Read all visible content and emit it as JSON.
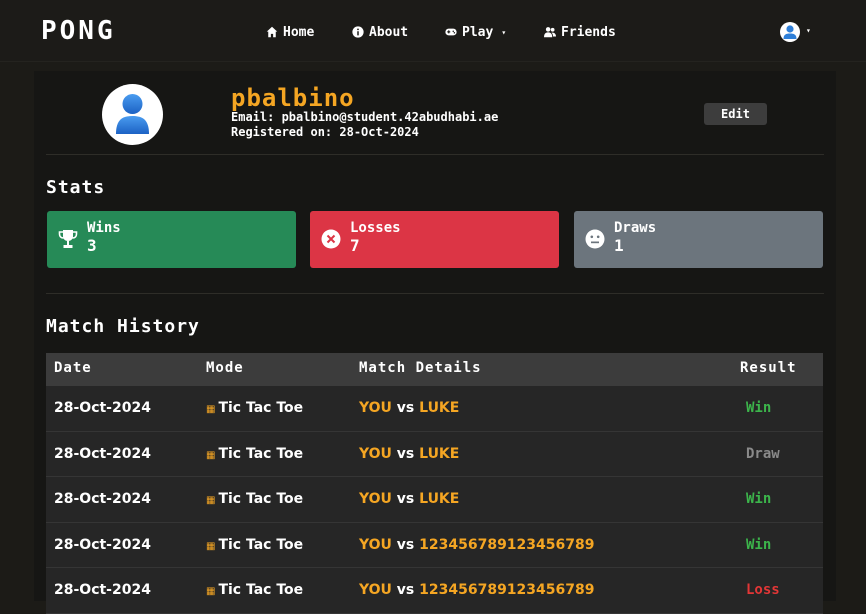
{
  "nav": {
    "brand": "PONG",
    "home": "Home",
    "about": "About",
    "play": "Play",
    "friends": "Friends"
  },
  "profile": {
    "username": "pbalbino",
    "email_line": "Email: pbalbino@student.42abudhabi.ae",
    "registered_line": "Registered on: 28-Oct-2024",
    "edit_label": "Edit"
  },
  "stats": {
    "title": "Stats",
    "wins_label": "Wins",
    "wins_value": "3",
    "losses_label": "Losses",
    "losses_value": "7",
    "draws_label": "Draws",
    "draws_value": "1"
  },
  "history": {
    "title": "Match History",
    "headers": {
      "date": "Date",
      "mode": "Mode",
      "details": "Match Details",
      "result": "Result"
    },
    "rows": [
      {
        "date": "28-Oct-2024",
        "mode": "Tic Tac Toe",
        "you": "YOU",
        "vs": "vs",
        "opponent": "LUKE",
        "result": "Win"
      },
      {
        "date": "28-Oct-2024",
        "mode": "Tic Tac Toe",
        "you": "YOU",
        "vs": "vs",
        "opponent": "LUKE",
        "result": "Draw"
      },
      {
        "date": "28-Oct-2024",
        "mode": "Tic Tac Toe",
        "you": "YOU",
        "vs": "vs",
        "opponent": "LUKE",
        "result": "Win"
      },
      {
        "date": "28-Oct-2024",
        "mode": "Tic Tac Toe",
        "you": "YOU",
        "vs": "vs",
        "opponent": "123456789123456789",
        "result": "Win"
      },
      {
        "date": "28-Oct-2024",
        "mode": "Tic Tac Toe",
        "you": "YOU",
        "vs": "vs",
        "opponent": "123456789123456789",
        "result": "Loss"
      }
    ]
  },
  "colors": {
    "accent": "#f5a623",
    "win_green": "#2e8b57",
    "loss_red": "#dc3545",
    "draw_gray": "#6c757d",
    "result_win": "#3cb44b",
    "result_draw": "#8a8a8a",
    "result_loss": "#e23636"
  }
}
